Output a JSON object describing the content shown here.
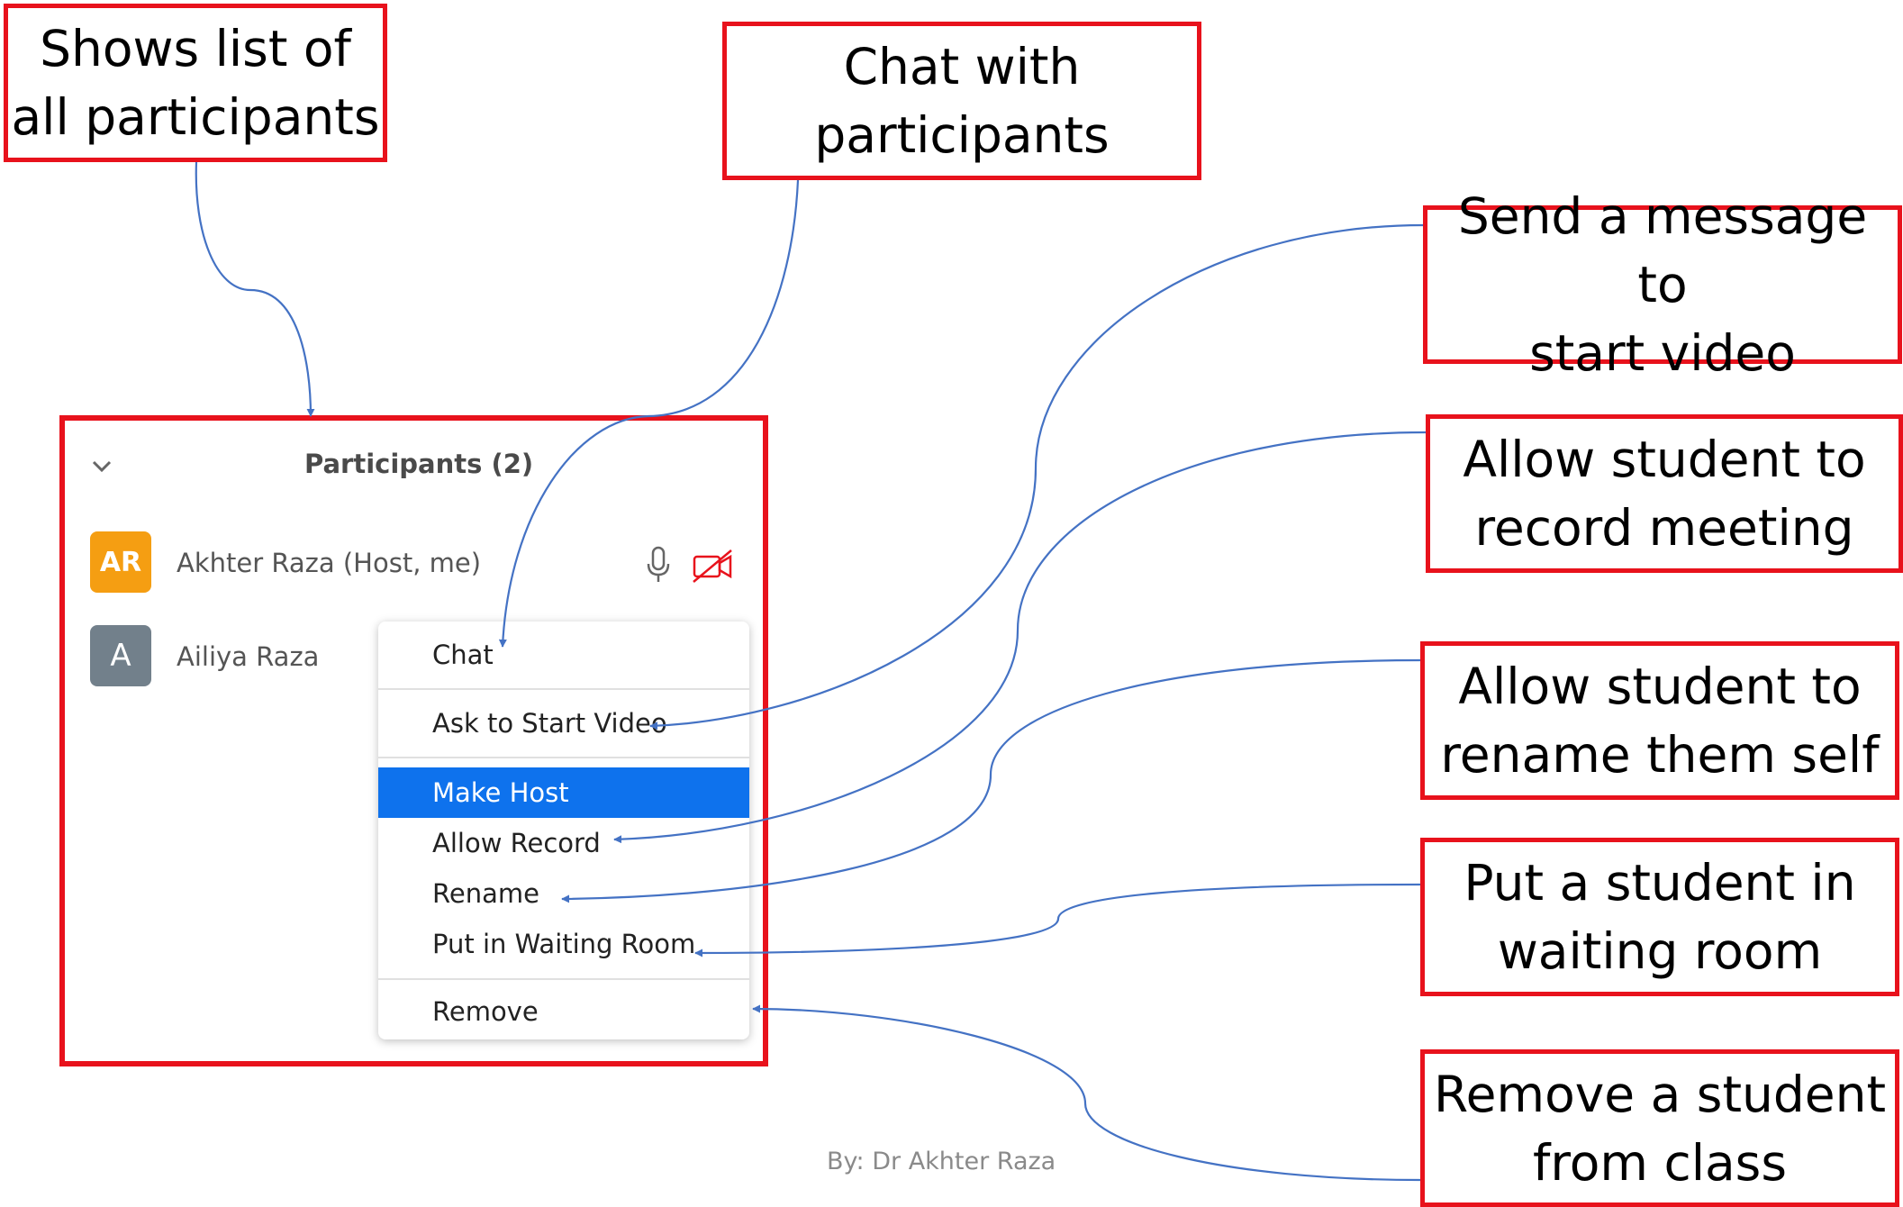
{
  "callouts": {
    "participants_list": "Shows list of\nall participants",
    "chat": "Chat with\nparticipants",
    "start_video": "Send a message to\nstart video",
    "record": "Allow student to\nrecord meeting",
    "rename": "Allow student to\nrename them self",
    "waiting_room": "Put a student in\nwaiting room",
    "remove": "Remove a student\nfrom class"
  },
  "panel": {
    "title": "Participants (2)",
    "participants": [
      {
        "initials": "AR",
        "name": "Akhter Raza (Host, me)",
        "color": "#f59e12"
      },
      {
        "initials": "A",
        "name": "Ailiya Raza",
        "color": "#72808b"
      }
    ]
  },
  "menu": {
    "items": [
      "Chat",
      "Ask to Start Video",
      "Make Host",
      "Allow Record",
      "Rename",
      "Put in Waiting Room",
      "Remove"
    ],
    "highlighted": "Make Host",
    "highlight_color": "#0e72ed"
  },
  "credit": "By: Dr Akhter Raza",
  "colors": {
    "callout_border": "#e8121c",
    "arrow": "#4472c4"
  }
}
